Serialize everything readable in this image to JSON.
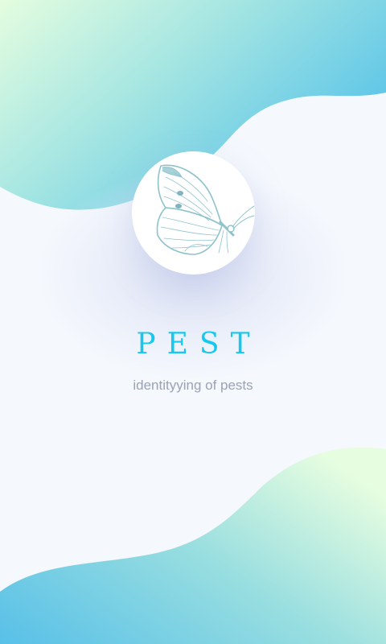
{
  "app": {
    "title": "PEST",
    "subtitle": "identityying of pests",
    "logo_icon": "butterfly-icon"
  },
  "colors": {
    "background": "#f5f8fd",
    "title": "#16c8ee",
    "subtitle": "#9aa3b5",
    "wave_light": "#e2fce0",
    "wave_dark": "#58c3e8"
  }
}
